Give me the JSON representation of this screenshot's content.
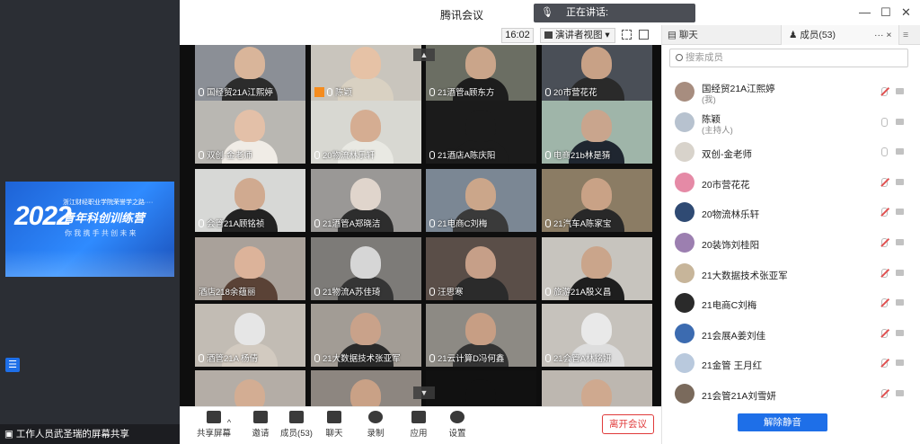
{
  "window": {
    "title": "腾讯会议",
    "speaking_label": "正在讲话:"
  },
  "share": {
    "status_text": "工作人员武圣瑞的屏幕共享",
    "slide": {
      "year": "2022",
      "line1": "浙江财经职业学院荣誉学之路····",
      "line2": "青年科创训练营",
      "line3": "你 我 携 手   共 创 未 来"
    }
  },
  "toolbar_top": {
    "time": "16:02",
    "view_label": "演讲者视图",
    "view_caret": "▾"
  },
  "video_grid": {
    "tiles": [
      {
        "name": "国经贸21A江熙婷",
        "mic": true,
        "host": false,
        "active": false,
        "bg": "#8b8f96",
        "skin": "#d9b59a",
        "cloth": "#2c2c2c"
      },
      {
        "name": "陈颖",
        "mic": true,
        "host": true,
        "active": true,
        "bg": "#c9c5bd",
        "skin": "#e6c2a6",
        "cloth": "#d9d1c2"
      },
      {
        "name": "21酒管a顾东方",
        "mic": true,
        "host": false,
        "active": false,
        "bg": "#6b6e63",
        "skin": "#caa58a",
        "cloth": "#1d1d1d"
      },
      {
        "name": "20市营花花",
        "mic": true,
        "host": false,
        "active": false,
        "bg": "#4a4f57",
        "skin": "#c8a186",
        "cloth": "#2a2a2a"
      },
      {
        "name": "双创-金老师",
        "mic": true,
        "host": false,
        "active": false,
        "bg": "#b9b7b2",
        "skin": "#e3c0a8",
        "cloth": "#f0ece6"
      },
      {
        "name": "20物流林乐轩",
        "mic": true,
        "host": false,
        "active": false,
        "bg": "#d8d8d2",
        "skin": "#d5ad92",
        "cloth": "#e9e9e3"
      },
      {
        "name": "21酒店A陈庆阳",
        "mic": true,
        "host": false,
        "active": false,
        "bg": "#1b1b1b",
        "skin": "#1b1b1b",
        "cloth": "#1b1b1b"
      },
      {
        "name": "电商21b林是猜",
        "mic": true,
        "host": false,
        "active": false,
        "bg": "#9fb5a9",
        "skin": "#c9a58d",
        "cloth": "#1f2630"
      },
      {
        "name": "会管21A顾铭祯",
        "mic": true,
        "host": false,
        "active": false,
        "bg": "#d7d8d6",
        "skin": "#d0aa90",
        "cloth": "#222"
      },
      {
        "name": "21酒管A郑晓洁",
        "mic": true,
        "host": false,
        "active": false,
        "bg": "#9a9896",
        "skin": "#e0d5cc",
        "cloth": "#2d2d2d"
      },
      {
        "name": "21电商C刘梅",
        "mic": true,
        "host": false,
        "active": false,
        "bg": "#7b8794",
        "skin": "#cba68a",
        "cloth": "#3a3a3a"
      },
      {
        "name": "21汽车A陈家宝",
        "mic": true,
        "host": false,
        "active": false,
        "bg": "#8b7c64",
        "skin": "#c9a286",
        "cloth": "#282828"
      },
      {
        "name": "酒店218余蕴丽",
        "mic": false,
        "host": false,
        "active": false,
        "bg": "#a9a19a",
        "skin": "#dcb39a",
        "cloth": "#5a4236"
      },
      {
        "name": "21物流A苏佳琦",
        "mic": true,
        "host": false,
        "active": false,
        "bg": "#7d7b78",
        "skin": "#d6d6d6",
        "cloth": "#353535"
      },
      {
        "name": "汪思寒",
        "mic": true,
        "host": false,
        "active": false,
        "bg": "#5a4e48",
        "skin": "#c69f88",
        "cloth": "#2b2b2b"
      },
      {
        "name": "旅游21A殷义昌",
        "mic": true,
        "host": false,
        "active": false,
        "bg": "#c7c4be",
        "skin": "#caa58b",
        "cloth": "#1e1e1e"
      },
      {
        "name": "酒管21A 杨倩",
        "mic": true,
        "host": false,
        "active": false,
        "bg": "#c2bcb4",
        "skin": "#e6e6e6",
        "cloth": "#d2cac0"
      },
      {
        "name": "21大数据技术张亚军",
        "mic": true,
        "host": false,
        "active": false,
        "bg": "#a29c95",
        "skin": "#c9a28a",
        "cloth": "#2a2a2a"
      },
      {
        "name": "21云计算D冯何鑫",
        "mic": true,
        "host": false,
        "active": false,
        "bg": "#8d8a84",
        "skin": "#c79e84",
        "cloth": "#333"
      },
      {
        "name": "21会管A林铭妍",
        "mic": true,
        "host": false,
        "active": false,
        "bg": "#c6c2bc",
        "skin": "#e9e9e9",
        "cloth": "#ddd"
      },
      {
        "name": "",
        "mic": false,
        "host": false,
        "active": false,
        "bg": "#b4ada6",
        "skin": "#d3ad93",
        "cloth": "#cfc8bf"
      },
      {
        "name": "",
        "mic": false,
        "host": false,
        "active": false,
        "bg": "#8d8680",
        "skin": "#c9a186",
        "cloth": "#333"
      },
      {
        "name": "",
        "mic": false,
        "host": false,
        "active": false,
        "bg": "#111",
        "skin": "#111",
        "cloth": "#111"
      },
      {
        "name": "",
        "mic": false,
        "host": false,
        "active": false,
        "bg": "#bdb7b0",
        "skin": "#cfa98f",
        "cloth": "#bbb"
      }
    ]
  },
  "bottom_toolbar": {
    "share_screen": "共享屏幕",
    "invite": "邀请",
    "members": "成员(53)",
    "chat": "聊天",
    "record": "录制",
    "apps": "应用",
    "settings": "设置",
    "leave": "离开会议"
  },
  "right_panel": {
    "tab_chat": "聊天",
    "tab_members": "成员(53)",
    "more": "··· ×",
    "search_placeholder": "搜索成员",
    "members": [
      {
        "name": "国经贸21A江熙婷",
        "role": "(我)",
        "avatar_color": "#a78d7f",
        "muted": true
      },
      {
        "name": "陈颖",
        "role": "(主持人)",
        "avatar_color": "#b7c2cf",
        "muted": false
      },
      {
        "name": "双创-金老师",
        "role": "",
        "avatar_color": "#d8d3cb",
        "muted": false
      },
      {
        "name": "20市营花花",
        "role": "",
        "avatar_color": "#e58aa6",
        "muted": true
      },
      {
        "name": "20物流林乐轩",
        "role": "",
        "avatar_color": "#2f4a73",
        "muted": true
      },
      {
        "name": "20装饰刘桂阳",
        "role": "",
        "avatar_color": "#9c7fb0",
        "muted": true
      },
      {
        "name": "21大数据技术张亚军",
        "role": "",
        "avatar_color": "#c7b59a",
        "muted": true
      },
      {
        "name": "21电商C刘梅",
        "role": "",
        "avatar_color": "#2a2a2a",
        "muted": true
      },
      {
        "name": "21会展A姜刘佳",
        "role": "",
        "avatar_color": "#3c6bb0",
        "muted": true
      },
      {
        "name": "21金管 王月红",
        "role": "",
        "avatar_color": "#b9c9dd",
        "muted": true
      },
      {
        "name": "21会管21A刘雪妍",
        "role": "",
        "avatar_color": "#7a6a5c",
        "muted": true
      }
    ],
    "unmute_all": "解除静音"
  }
}
